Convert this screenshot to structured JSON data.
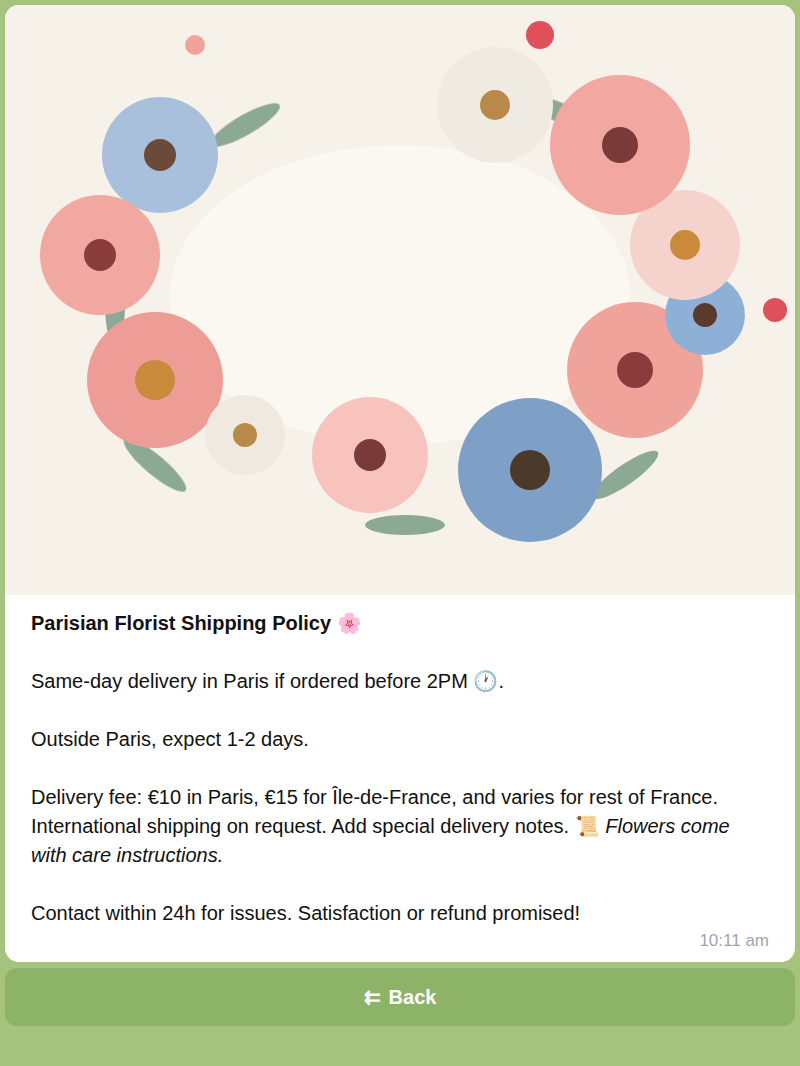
{
  "message": {
    "title": "Parisian Florist Shipping Policy 🌸",
    "paragraphs": [
      [
        {
          "kind": "plain",
          "text": "Same-day delivery in Paris if ordered before 2PM 🕐."
        }
      ],
      [
        {
          "kind": "plain",
          "text": "Outside Paris, expect 1-2 days."
        }
      ],
      [
        {
          "kind": "plain",
          "text": "Delivery fee: €10 in Paris, €15 for Île-de-France, and varies for rest of France. International shipping on request. Add special delivery notes. 📜 "
        },
        {
          "kind": "italic",
          "text": "Flowers come with care instructions."
        }
      ],
      [
        {
          "kind": "plain",
          "text": "Contact within 24h for issues. Satisfaction or refund promised!"
        }
      ]
    ],
    "time": "10:11 am"
  },
  "button": {
    "icon": "⇇",
    "label": "Back"
  }
}
